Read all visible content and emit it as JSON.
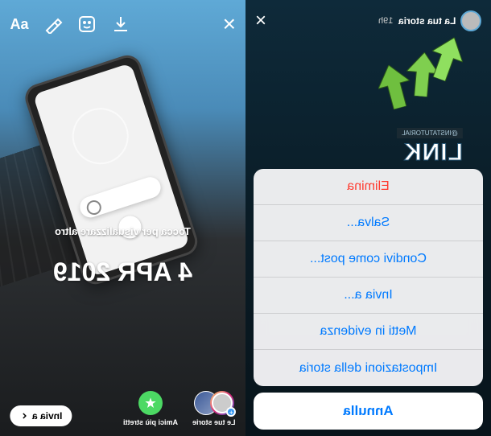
{
  "left": {
    "tap_hint": "Tocca per visualizzare altro",
    "date": "4 APR 2019",
    "send_button": "Invia a",
    "destinations": {
      "close_friends": "Amici più stretti",
      "your_stories": "Le tue storie"
    },
    "icons": {
      "text_tool": "Aa",
      "draw_tool": "draw",
      "sticker_tool": "sticker",
      "download_tool": "download",
      "close": "×"
    }
  },
  "right": {
    "close": "×",
    "header": {
      "username": "La tua storia",
      "time": "19h"
    },
    "badge_sub": "@INSTATUTORIAL",
    "badge_main": "LINK",
    "menu": {
      "delete": "Elimina",
      "save": "Salva...",
      "share_as_post": "Condivi come post...",
      "send_to": "Invia a...",
      "highlight": "Metti in evidenza",
      "story_settings": "Impostazioni della storia"
    },
    "cancel": "Annulla"
  },
  "colors": {
    "ios_blue": "#007aff",
    "ios_red": "#ff3b30",
    "ig_green": "#4cd964"
  }
}
